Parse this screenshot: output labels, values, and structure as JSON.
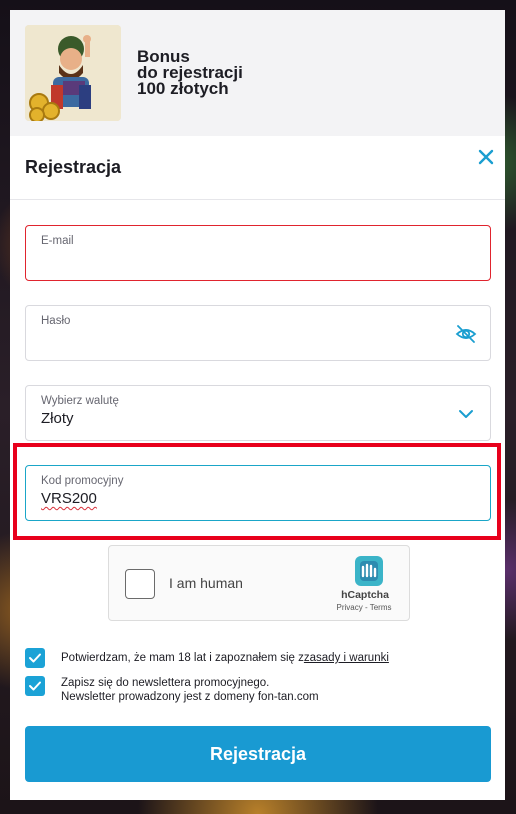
{
  "banner": {
    "line1": "Bonus",
    "line2": "do rejestracji",
    "line3": "100 złotych"
  },
  "form": {
    "title": "Rejestracja",
    "email": {
      "label": "E-mail",
      "value": ""
    },
    "password": {
      "label": "Hasło",
      "value": ""
    },
    "currency": {
      "label": "Wybierz walutę",
      "value": "Złoty"
    },
    "promo": {
      "label": "Kod promocyjny",
      "value": "VRS200"
    }
  },
  "captcha": {
    "text": "I am human",
    "brand": "hCaptcha",
    "privacy": "Privacy",
    "separator": " - ",
    "terms": "Terms"
  },
  "consents": {
    "age_text": "Potwierdzam, że mam 18 lat i zapoznałem się z",
    "age_link": "zasady i warunki",
    "newsletter_line1": "Zapisz się do newslettera promocyjnego.",
    "newsletter_line2": "Newsletter prowadzony jest z domeny fon-tan.com"
  },
  "submit_label": "Rejestracja",
  "colors": {
    "accent": "#199ad2",
    "error": "#e0242e",
    "highlight": "#e8001c",
    "focus": "#1aa6c8"
  },
  "icons": {
    "close": "close-icon",
    "password_toggle": "eye-off-icon",
    "dropdown": "chevron-down-icon",
    "checkbox": "check-icon",
    "captcha_logo": "hcaptcha-logo-icon"
  }
}
